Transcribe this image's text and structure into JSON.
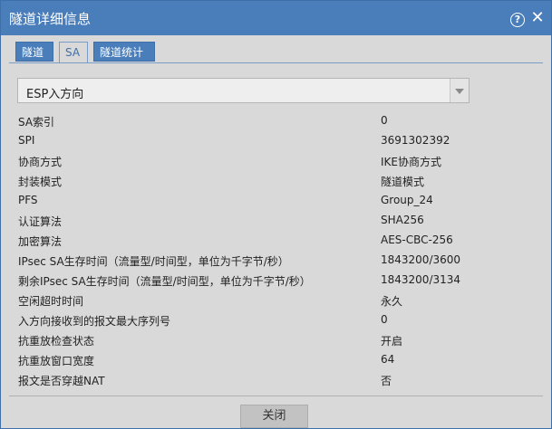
{
  "window": {
    "title": "隧道详细信息",
    "help_symbol": "?",
    "close_symbol": "✕"
  },
  "tabs": [
    {
      "label": "隧道",
      "active": false
    },
    {
      "label": "SA",
      "active": true
    },
    {
      "label": "隧道统计",
      "active": false
    }
  ],
  "sa_select": {
    "value": "ESP入方向"
  },
  "fields": [
    {
      "label": "SA索引",
      "value": "0"
    },
    {
      "label": "SPI",
      "value": "3691302392"
    },
    {
      "label": "协商方式",
      "value": "IKE协商方式"
    },
    {
      "label": "封装模式",
      "value": "隧道模式"
    },
    {
      "label": "PFS",
      "value": "Group_24"
    },
    {
      "label": "认证算法",
      "value": "SHA256"
    },
    {
      "label": "加密算法",
      "value": "AES-CBC-256"
    },
    {
      "label": "IPsec SA生存时间（流量型/时间型，单位为千字节/秒）",
      "value": "1843200/3600"
    },
    {
      "label": "剩余IPsec SA生存时间（流量型/时间型，单位为千字节/秒）",
      "value": "1843200/3134"
    },
    {
      "label": "空闲超时时间",
      "value": "永久"
    },
    {
      "label": "入方向接收到的报文最大序列号",
      "value": "0"
    },
    {
      "label": "抗重放检查状态",
      "value": "开启"
    },
    {
      "label": "抗重放窗口宽度",
      "value": "64"
    },
    {
      "label": "报文是否穿越NAT",
      "value": "否"
    }
  ],
  "footer": {
    "close_label": "关闭"
  }
}
